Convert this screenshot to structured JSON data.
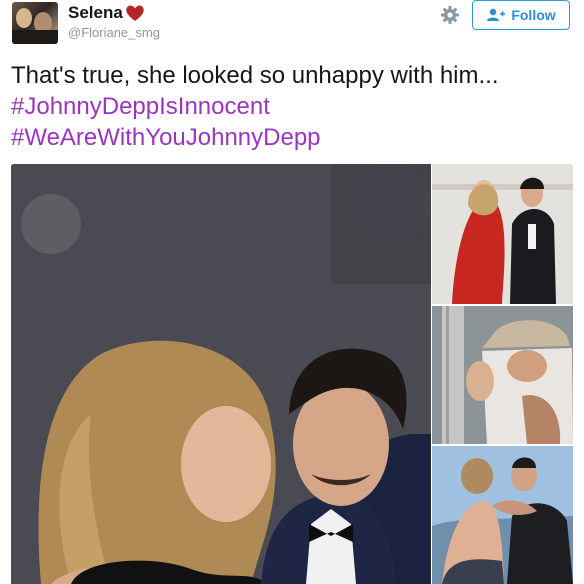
{
  "tweet": {
    "author_name": "Selena",
    "author_handle": "@Floriane_smg",
    "follow_label": "Follow",
    "text": "That's true, she looked so unhappy with him...",
    "hashtags": [
      "#JohnnyDeppIsInnocent",
      "#WeAreWithYouJohnnyDepp"
    ]
  },
  "icons": {
    "heart": "heart-icon",
    "settings": "gear-icon",
    "follow": "add-user-icon"
  },
  "colors": {
    "hashtag": "#9b35c0",
    "follow_blue": "#2a9bdb",
    "handle_gray": "#8899a6",
    "heart_red": "#b3262a"
  }
}
